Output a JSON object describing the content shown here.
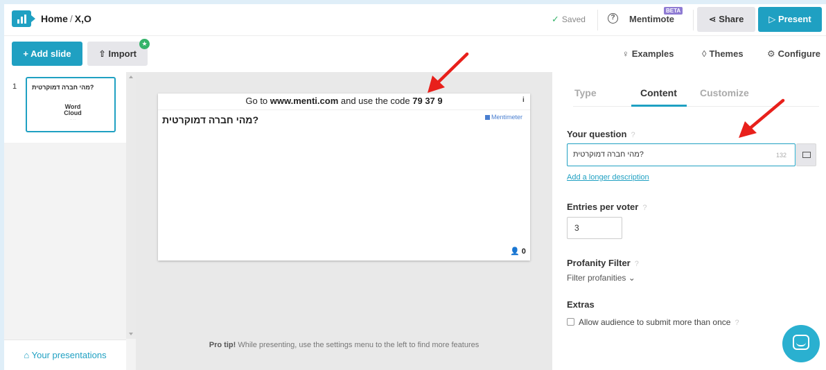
{
  "header": {
    "home": "Home",
    "separator": "/",
    "presentation": "X,O",
    "status": "Saved",
    "mentimote": "Mentimote",
    "beta": "BETA",
    "share": "Share",
    "present": "Present"
  },
  "toolbar": {
    "add_slide": "+ Add slide",
    "import": "Import",
    "examples": "Examples",
    "themes": "Themes",
    "configure": "Configure"
  },
  "slides": [
    {
      "number": "1",
      "title": "?מהי חברה דמוקרטית",
      "thumb_words": [
        "Word",
        "Cloud"
      ]
    }
  ],
  "sidebar": {
    "your_presentations": "Your presentations"
  },
  "preview": {
    "code_prefix": "Go to ",
    "url": "www.menti.com",
    "code_mid": " and use the code ",
    "code": "79 37 9",
    "info": "i",
    "question": "?מהי חברה דמוקרטית",
    "brand": "Mentimeter",
    "participants": "0"
  },
  "protip": {
    "bold": "Pro tip!",
    "text": " While presenting, use the settings menu to the left to find more features"
  },
  "editor": {
    "tabs": [
      "Type",
      "Content",
      "Customize"
    ],
    "active_tab": "Content",
    "question_label": "Your question",
    "help": "?",
    "question_value": "?מהי חברה דמוקרטית",
    "char_count": "132",
    "longer_description": "Add a longer description",
    "entries_label": "Entries per voter",
    "entries_value": "3",
    "profanity_label": "Profanity Filter",
    "profanity_value": "Filter profanities",
    "extras_label": "Extras",
    "extras_option": "Allow audience to submit more than once"
  },
  "colors": {
    "accent": "#1fa0c2",
    "annotation_arrow": "#e8201b",
    "saved_check": "#35b36a"
  },
  "icons": [
    "mentimeter-logo-icon",
    "check-icon",
    "help-icon",
    "share-icon",
    "play-icon",
    "upload-icon",
    "star-icon",
    "bulb-icon",
    "drop-icon",
    "gear-icon",
    "home-icon",
    "user-icon",
    "image-icon",
    "chevron-down-icon",
    "chat-icon"
  ]
}
